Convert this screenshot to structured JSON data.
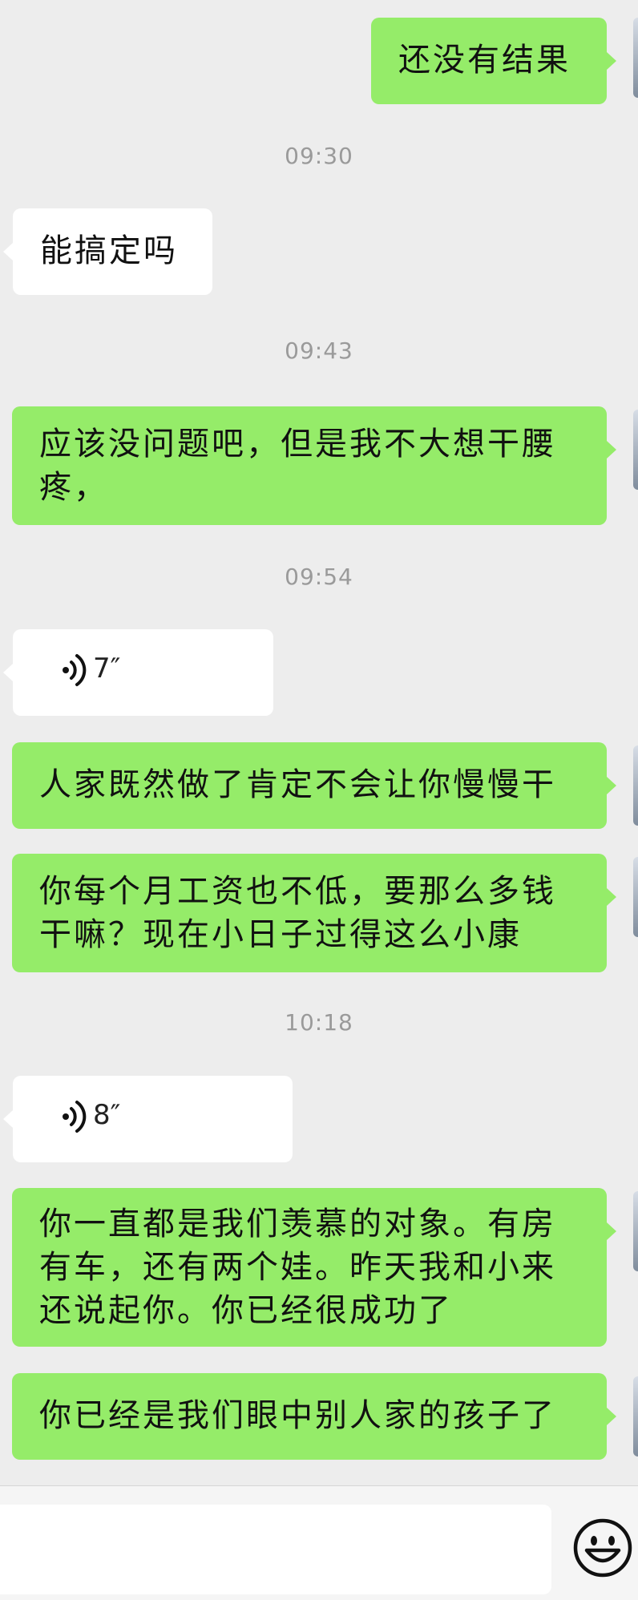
{
  "messages": [
    {
      "type": "text",
      "side": "out",
      "text": "还没有结果"
    },
    {
      "type": "time",
      "text": "09:30"
    },
    {
      "type": "text",
      "side": "in",
      "text": "能搞定吗"
    },
    {
      "type": "time",
      "text": "09:43"
    },
    {
      "type": "text",
      "side": "out",
      "text": "应该没问题吧，但是我不大想干腰疼，"
    },
    {
      "type": "time",
      "text": "09:54"
    },
    {
      "type": "voice",
      "side": "in",
      "duration": "7″"
    },
    {
      "type": "text",
      "side": "out",
      "text": "人家既然做了肯定不会让你慢慢干"
    },
    {
      "type": "text",
      "side": "out",
      "text": "你每个月工资也不低，要那么多钱干嘛？现在小日子过得这么小康"
    },
    {
      "type": "time",
      "text": "10:18"
    },
    {
      "type": "voice",
      "side": "in",
      "duration": "8″"
    },
    {
      "type": "text",
      "side": "out",
      "text": "你一直都是我们羡慕的对象。有房有车，还有两个娃。昨天我和小来还说起你。你已经很成功了"
    },
    {
      "type": "text",
      "side": "out",
      "text": "你已经是我们眼中别人家的孩子了"
    }
  ],
  "input": {
    "value": "",
    "emoji_icon": "emoji-smile-icon"
  },
  "colors": {
    "outgoing": "#95ec69",
    "incoming": "#ffffff",
    "background": "#ededed",
    "timestamp": "#9a9a9a"
  }
}
